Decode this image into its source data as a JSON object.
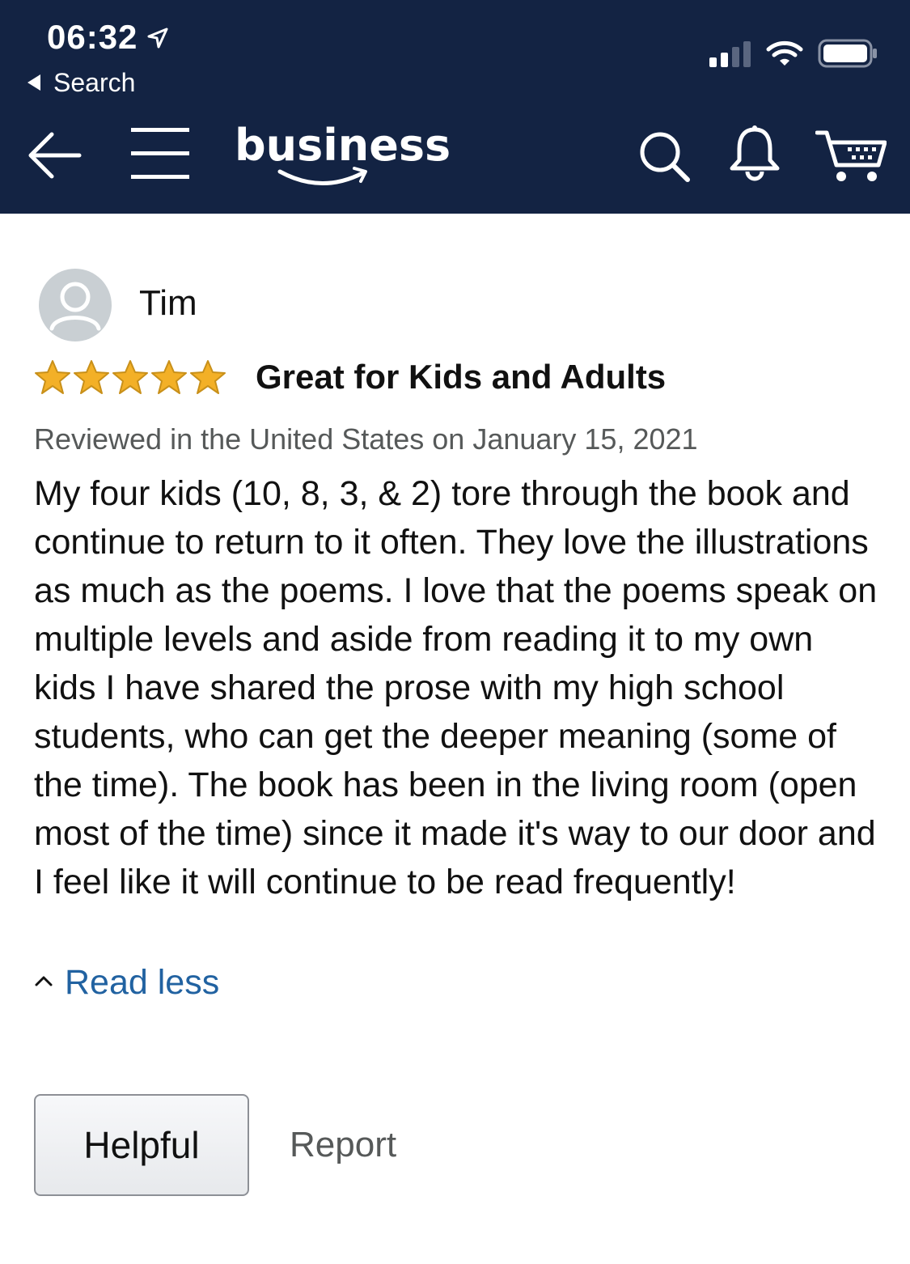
{
  "status_bar": {
    "time": "06:32",
    "back_app_label": "Search"
  },
  "nav": {
    "logo_text": "business",
    "icons": [
      "back-arrow-icon",
      "menu-icon",
      "search-icon",
      "bell-icon",
      "cart-icon"
    ]
  },
  "review": {
    "reviewer_name": "Tim",
    "rating": 5,
    "rating_max": 5,
    "title": "Great for Kids and Adults",
    "meta": "Reviewed in the United States on January 15, 2021",
    "body": "My four kids (10, 8, 3, & 2) tore through the book and continue to return to it often. They love the illustrations as much as the poems. I love that the poems speak on multiple levels and aside from reading it to my own kids I have shared the prose with my high school students, who can get the deeper meaning (some of the time). The book has been in the living room (open most of the time) since it made it's way to our door and I feel like it will continue to be read frequently!",
    "read_less_label": "Read less"
  },
  "actions": {
    "helpful_label": "Helpful",
    "report_label": "Report"
  },
  "colors": {
    "header_bg": "#132343",
    "star": "#f3b027",
    "link": "#2162a1",
    "meta_text": "#565959"
  }
}
